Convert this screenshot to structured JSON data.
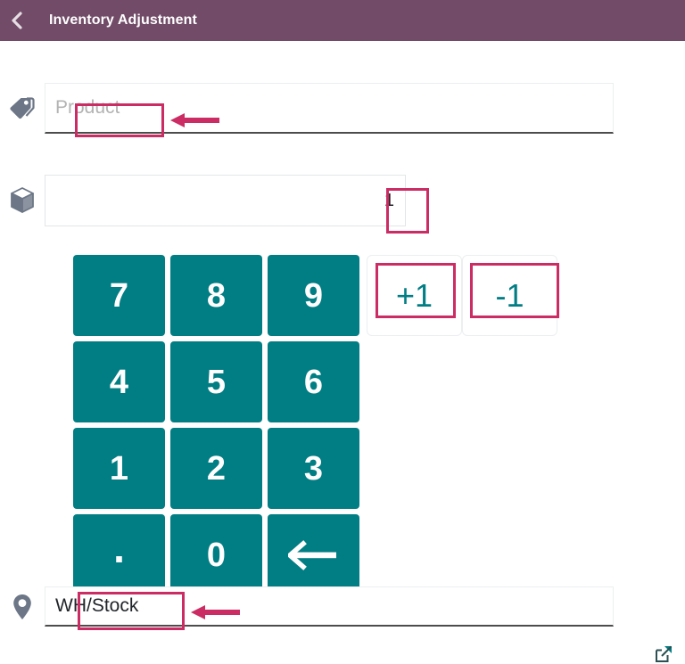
{
  "header": {
    "back_icon": "chevron-left-icon",
    "title": "Inventory Adjustment",
    "background_color": "#714B67",
    "text_color": "#FFFFFF"
  },
  "form": {
    "product_field": {
      "icon": "tags-icon",
      "placeholder": "Product",
      "value": ""
    },
    "quantity_field": {
      "icon": "cube-icon",
      "value": "1"
    },
    "location_field": {
      "icon": "map-marker-icon",
      "value": "WH/Stock",
      "external_link_icon": "external-link-icon"
    }
  },
  "numpad": {
    "background_color": "#017E84",
    "text_color": "#FFFFFF",
    "keys": [
      {
        "label": "7",
        "name": "key-7"
      },
      {
        "label": "8",
        "name": "key-8"
      },
      {
        "label": "9",
        "name": "key-9"
      },
      {
        "label": "4",
        "name": "key-4"
      },
      {
        "label": "5",
        "name": "key-5"
      },
      {
        "label": "6",
        "name": "key-6"
      },
      {
        "label": "1",
        "name": "key-1"
      },
      {
        "label": "2",
        "name": "key-2"
      },
      {
        "label": "3",
        "name": "key-3"
      },
      {
        "label": ".",
        "name": "key-decimal"
      },
      {
        "label": "0",
        "name": "key-0"
      },
      {
        "label": "",
        "name": "key-backspace"
      }
    ]
  },
  "increment_buttons": {
    "text_color": "#017E84",
    "plus_one": "+1",
    "minus_one": "-1"
  },
  "annotations": {
    "color": "#CB2C63",
    "boxes": [
      "product-placeholder",
      "quantity-value",
      "plus-one-button",
      "minus-one-button",
      "location-value"
    ],
    "arrows": [
      "arrow-to-product",
      "arrow-to-location"
    ]
  }
}
